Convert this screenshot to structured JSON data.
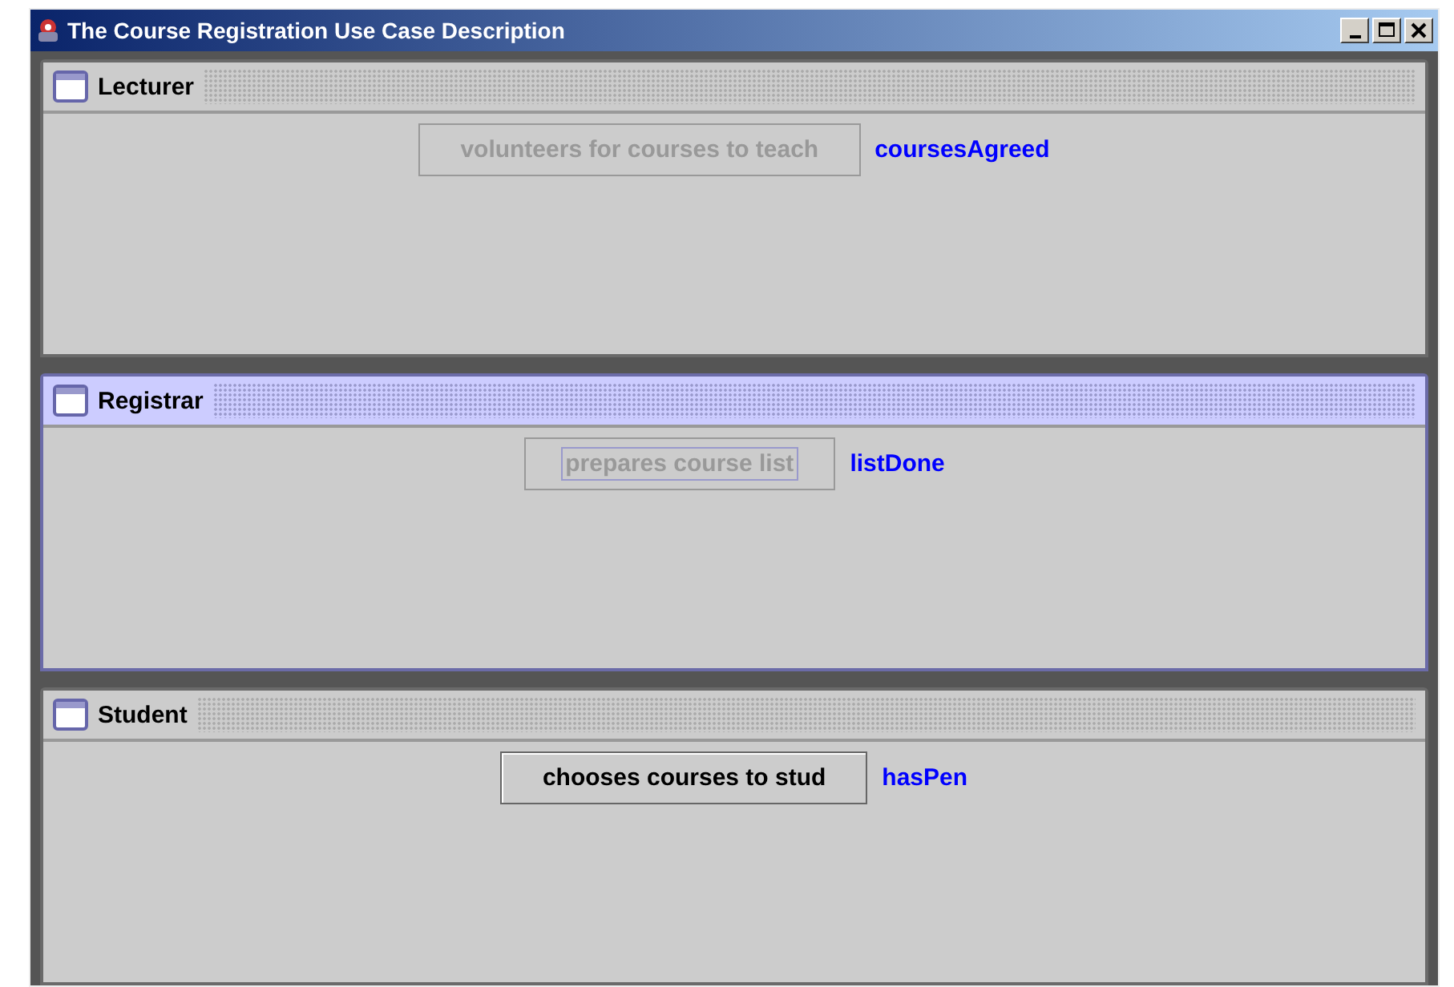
{
  "window": {
    "title": "The Course Registration Use Case Description"
  },
  "frames": [
    {
      "title": "Lecturer",
      "selected": false,
      "button": {
        "label": "volunteers for courses to teach",
        "disabled": true,
        "focused": false
      },
      "status": "coursesAgreed"
    },
    {
      "title": "Registrar",
      "selected": true,
      "button": {
        "label": "prepares course list",
        "disabled": true,
        "focused": true
      },
      "status": "listDone"
    },
    {
      "title": "Student",
      "selected": false,
      "button": {
        "label": "chooses courses to stud",
        "disabled": false,
        "focused": false
      },
      "status": "hasPen"
    }
  ]
}
